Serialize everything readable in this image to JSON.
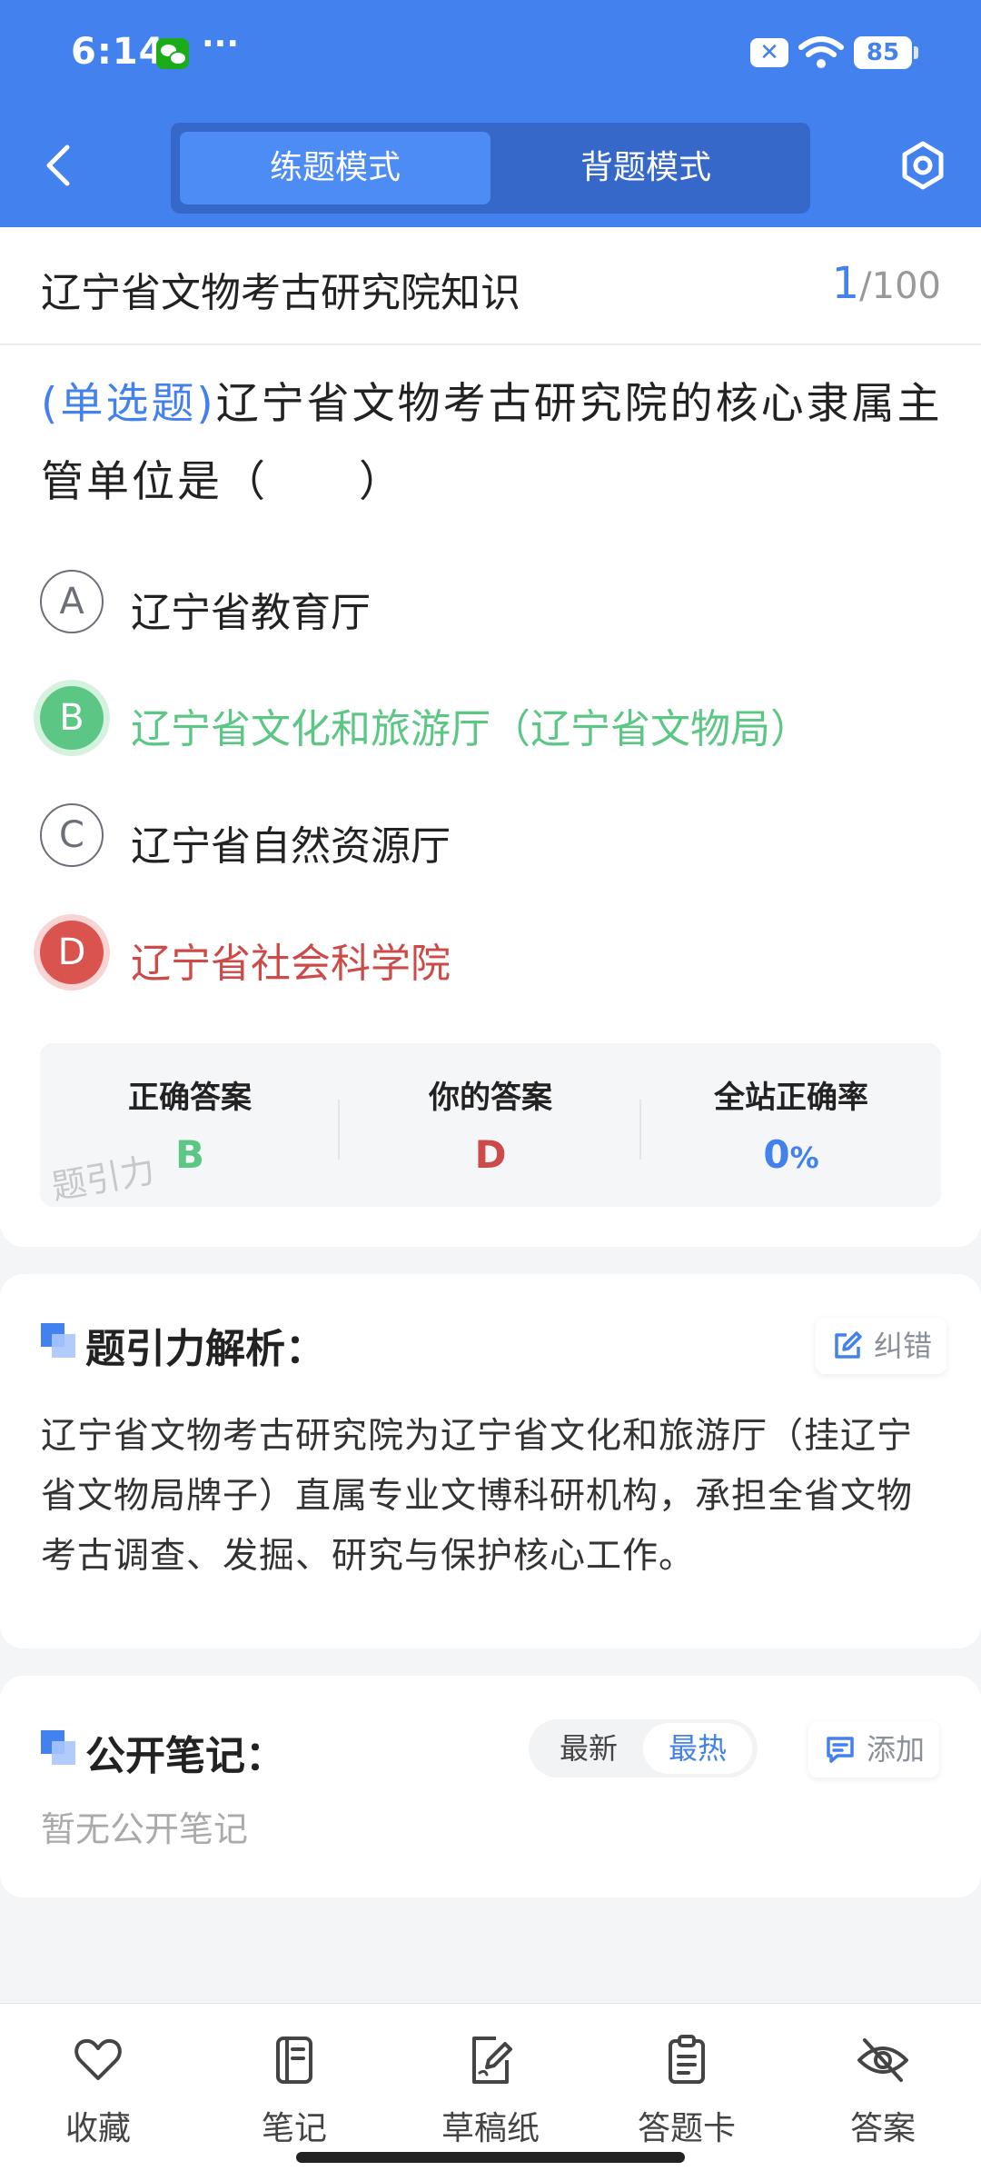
{
  "status_bar": {
    "time": "6:14",
    "dots": "···",
    "battery": "85",
    "x_badge": "✕"
  },
  "header": {
    "mode_practice": "练题模式",
    "mode_memorize": "背题模式"
  },
  "bank": {
    "title": "辽宁省文物考古研究院知识",
    "current": "1",
    "total": "/100"
  },
  "question": {
    "type_label": "(单选题)",
    "text": "辽宁省文物考古研究院的核心隶属主管单位是（　　）"
  },
  "options": [
    {
      "letter": "A",
      "text": "辽宁省教育厅",
      "state": "normal"
    },
    {
      "letter": "B",
      "text": "辽宁省文化和旅游厅（辽宁省文物局）",
      "state": "correct"
    },
    {
      "letter": "C",
      "text": "辽宁省自然资源厅",
      "state": "normal"
    },
    {
      "letter": "D",
      "text": "辽宁省社会科学院",
      "state": "wrong"
    }
  ],
  "result": {
    "correct_label": "正确答案",
    "correct_value": "B",
    "yours_label": "你的答案",
    "yours_value": "D",
    "rate_label": "全站正确率",
    "rate_value": "0",
    "rate_unit": "%",
    "watermark": "题引力"
  },
  "analysis": {
    "title": "题引力解析：",
    "report_label": "纠错",
    "text": "辽宁省文物考古研究院为辽宁省文化和旅游厅（挂辽宁省文物局牌子）直属专业文博科研机构，承担全省文物考古调查、发掘、研究与保护核心工作。"
  },
  "notes": {
    "title": "公开笔记：",
    "sort_latest": "最新",
    "sort_hot": "最热",
    "add_label": "添加",
    "empty": "暂无公开笔记"
  },
  "bottom_nav": [
    {
      "label": "收藏",
      "icon": "heart-icon"
    },
    {
      "label": "笔记",
      "icon": "notebook-icon"
    },
    {
      "label": "草稿纸",
      "icon": "draft-icon"
    },
    {
      "label": "答题卡",
      "icon": "answer-card-icon"
    },
    {
      "label": "答案",
      "icon": "eye-off-icon"
    }
  ],
  "colors": {
    "primary": "#4381ee",
    "correct": "#5cc785",
    "wrong": "#d9534f"
  }
}
